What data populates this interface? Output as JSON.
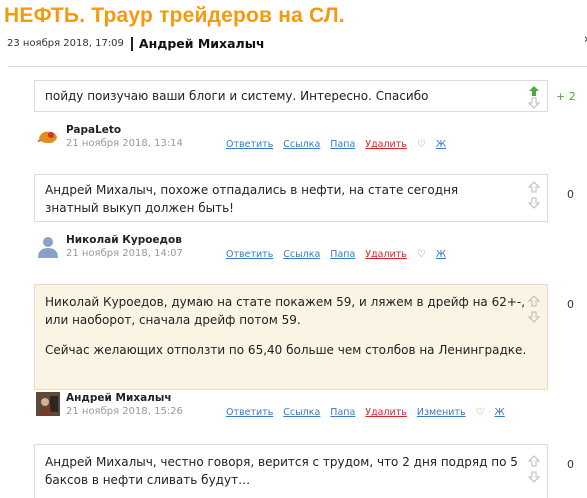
{
  "post": {
    "title": "НЕФТЬ. Траур трейдеров на СЛ.",
    "date": "23 ноября 2018, 17:09",
    "author": "Андрей Михалыч"
  },
  "colors": {
    "title": "#f39a0d",
    "link": "#3a78c9",
    "delete": "#d9262b",
    "positive": "#4aa93a",
    "highlight": "#fbf3e3"
  },
  "actions": {
    "reply": "Ответить",
    "link": "Ссылка",
    "parent": "Папа",
    "delete": "Удалить",
    "edit": "Изменить",
    "like": "♡",
    "bold": "Ж"
  },
  "comments": [
    {
      "text": "пойду поизучаю ваши блоги и систему. Интересно. Спасибо",
      "score": "+ 2",
      "upvoted": true,
      "author": "PapaLeto",
      "date": "21 ноября 2018, 13:14"
    },
    {
      "text": "Андрей Михалыч, похоже отпадались в нефти, на стате сегодня знатный выкуп должен быть!",
      "score": "0",
      "author": "Николай Куроедов",
      "date": "21 ноября 2018, 14:07"
    },
    {
      "text": "Николай Куроедов, думаю на стате покажем 59, и ляжем в дрейф на 62+-, или наоборот, сначала дрейф потом 59.",
      "text2": "Сейчас желающих отползти по 65,40  больше чем столбов на Ленинградке.",
      "score": "0",
      "author": "Андрей Михалыч",
      "date": "21 ноября 2018, 15:26"
    },
    {
      "text": "Андрей Михалыч, честно говоря, верится с трудом, что 2 дня подряд по 5 баксов в нефти сливать будут…",
      "score": "0"
    }
  ]
}
